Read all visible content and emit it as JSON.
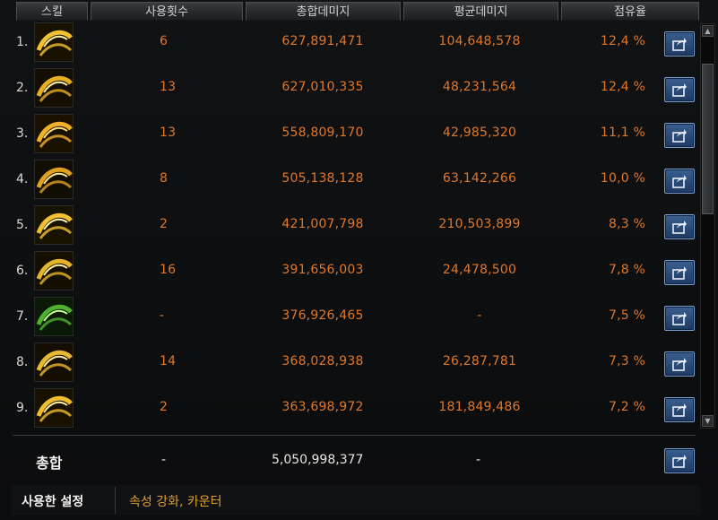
{
  "header": {
    "skill": "스킬",
    "uses": "사용횟수",
    "total_damage": "총합데미지",
    "avg_damage": "평균데미지",
    "share": "점유율"
  },
  "rows": [
    {
      "rank": "1.",
      "uses": "6",
      "total": "627,891,471",
      "avg": "104,648,578",
      "share": "12,4 %",
      "icon": "golden-slash-skill-icon"
    },
    {
      "rank": "2.",
      "uses": "13",
      "total": "627,010,335",
      "avg": "48,231,564",
      "share": "12,4 %",
      "icon": "golden-streak-skill-icon"
    },
    {
      "rank": "3.",
      "uses": "13",
      "total": "558,809,170",
      "avg": "42,985,320",
      "share": "11,1 %",
      "icon": "golden-spin-skill-icon"
    },
    {
      "rank": "4.",
      "uses": "8",
      "total": "505,138,128",
      "avg": "63,142,266",
      "share": "10,0 %",
      "icon": "golden-cross-skill-icon"
    },
    {
      "rank": "5.",
      "uses": "2",
      "total": "421,007,798",
      "avg": "210,503,899",
      "share": "8,3 %",
      "icon": "golden-orb-skill-icon"
    },
    {
      "rank": "6.",
      "uses": "16",
      "total": "391,656,003",
      "avg": "24,478,500",
      "share": "7,8 %",
      "icon": "golden-wave-skill-icon"
    },
    {
      "rank": "7.",
      "uses": "-",
      "total": "376,926,465",
      "avg": "-",
      "share": "7,5 %",
      "icon": "green-swirl-skill-icon"
    },
    {
      "rank": "8.",
      "uses": "14",
      "total": "368,028,938",
      "avg": "26,287,781",
      "share": "7,3 %",
      "icon": "golden-arc-skill-icon"
    },
    {
      "rank": "9.",
      "uses": "2",
      "total": "363,698,972",
      "avg": "181,849,486",
      "share": "7,2 %",
      "icon": "golden-burst-skill-icon"
    }
  ],
  "totals": {
    "label": "총합",
    "uses": "-",
    "total": "5,050,998,377",
    "avg": "-"
  },
  "footer": {
    "label": "사용한 설정",
    "value": "속성 강화, 카운터"
  },
  "colors": {
    "value_orange": "#e07828",
    "footer_gold": "#e0a030",
    "button_blue": "#2a4a78"
  }
}
